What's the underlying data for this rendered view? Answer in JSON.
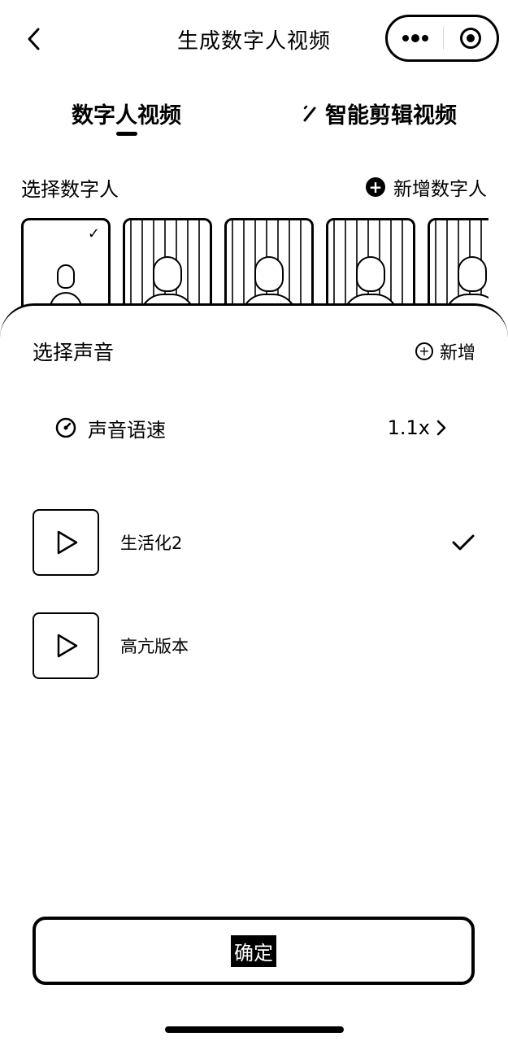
{
  "nav": {
    "title": "生成数字人视频"
  },
  "tabs": [
    {
      "label": "数字人视频",
      "active": true
    },
    {
      "label": "智能剪辑视频",
      "active": false,
      "icon": "magic-wand-icon"
    }
  ],
  "avatar_section": {
    "label": "选择数字人",
    "add_label": "新增数字人"
  },
  "voice_sheet": {
    "label": "选择声音",
    "add_label": "新增",
    "speed_label": "声音语速",
    "speed_value": "1.1x",
    "voices": [
      {
        "name": "生活化2",
        "selected": true
      },
      {
        "name": "高亢版本",
        "selected": false
      }
    ],
    "confirm_label": "确定"
  }
}
